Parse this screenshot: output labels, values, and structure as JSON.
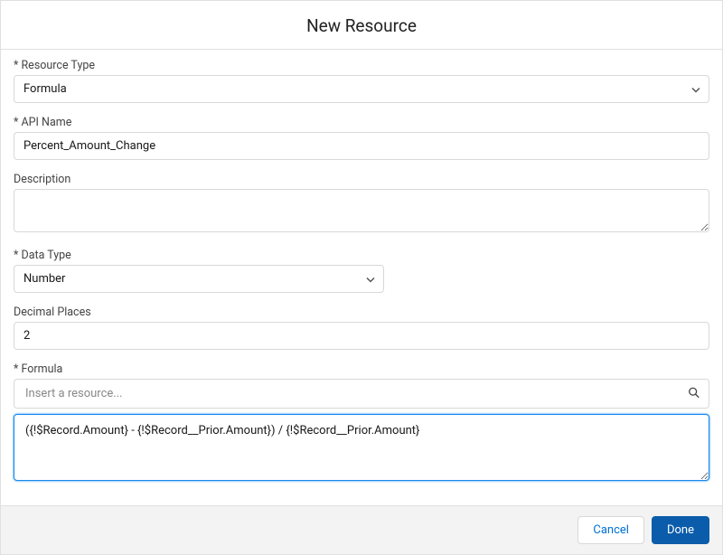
{
  "modal": {
    "title": "New Resource"
  },
  "fields": {
    "resourceType": {
      "label": "Resource Type",
      "value": "Formula"
    },
    "apiName": {
      "label": "API Name",
      "value": "Percent_Amount_Change"
    },
    "description": {
      "label": "Description",
      "value": ""
    },
    "dataType": {
      "label": "Data Type",
      "value": "Number"
    },
    "decimalPlaces": {
      "label": "Decimal Places",
      "value": "2"
    },
    "formula": {
      "label": "Formula",
      "resourcePlaceholder": "Insert a resource...",
      "value": "({!$Record.Amount} - {!$Record__Prior.Amount}) / {!$Record__Prior.Amount}"
    }
  },
  "footer": {
    "cancel": "Cancel",
    "done": "Done"
  }
}
